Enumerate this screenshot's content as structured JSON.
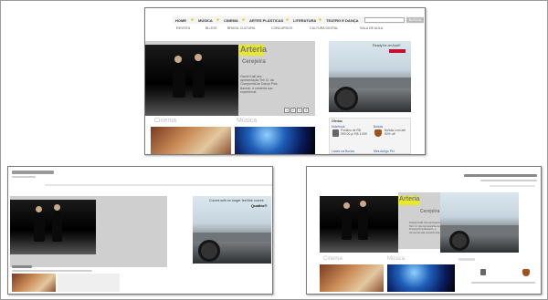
{
  "nav": {
    "items": [
      "HOME",
      "MÚSICA",
      "CINEMA",
      "ARTES PLÁSTICAS",
      "LITERATURA",
      "TEATRO E DANÇA"
    ],
    "search_button": "BUSCA"
  },
  "subnav": {
    "items": [
      "REVISTA",
      "BLOGS",
      "BRASIL CULTURA",
      "CONCURSOS",
      "CULTURA DIGITAL",
      "SALA DE AULA"
    ]
  },
  "feature": {
    "tag": "Arteria",
    "subtitle": "Cerejeira",
    "text": "Gisele Kalil vira apresentação Teh Cl. da Companhia de Dança Pina Bausch, e comenta sua experiência",
    "pages": [
      "1",
      "2",
      "3",
      "4"
    ]
  },
  "ad": {
    "headline": "Ready for an Audi?",
    "headline_alt": "Curves with no longer feel like curves",
    "brand": "Quattro®",
    "cta": "Audi AG"
  },
  "sections": {
    "cinema": "Cinema",
    "musica": "Música"
  },
  "ofertas": {
    "title": "Ofertas",
    "items": [
      {
        "name": "Notebook",
        "detail": "Positivo de R$ 999,00 p/ R$ 1.099",
        "cat": "NOTEBOOK"
      },
      {
        "name": "Bolsas",
        "detail": "Bolsas com até 50% off",
        "cat": "GALLARES"
      },
      {
        "name": "Lanes na Buzios",
        "detail": ""
      },
      {
        "name": "Mes Antigo Pel",
        "detail": ""
      }
    ]
  }
}
